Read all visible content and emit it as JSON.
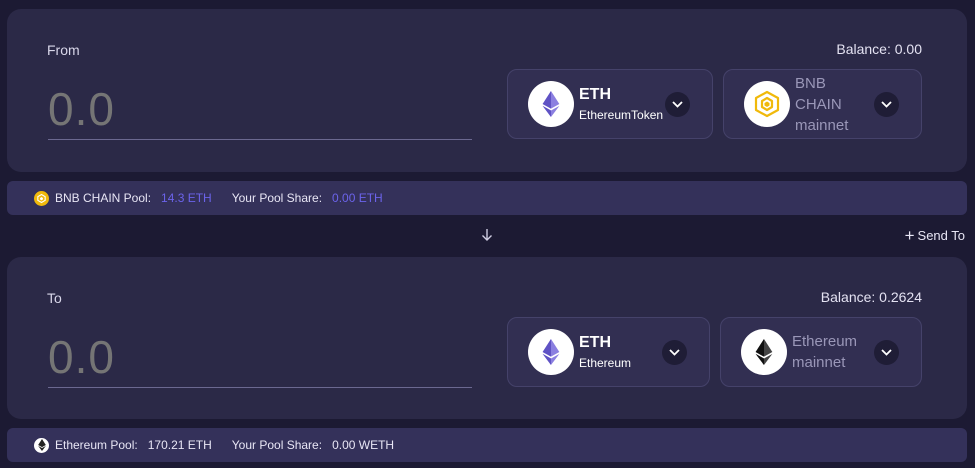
{
  "from": {
    "label": "From",
    "balance": "Balance: 0.00",
    "amount_placeholder": "0.0",
    "token": {
      "symbol": "ETH",
      "name": "EthereumToken",
      "icon": "ethereum-icon"
    },
    "network": {
      "name": "BNB CHAIN mainnet",
      "lines": [
        "BNB",
        "CHAIN",
        "mainnet"
      ],
      "icon": "bnb-chain-icon"
    },
    "pool": {
      "label": "BNB CHAIN Pool:",
      "value": "14.3 ETH",
      "share_label": "Your Pool Share:",
      "share_value": "0.00 ETH"
    }
  },
  "swap_arrow_icon": "arrow-down-icon",
  "send_to": {
    "icon": "plus-icon",
    "label": "Send To"
  },
  "to": {
    "label": "To",
    "balance": "Balance: 0.2624",
    "amount_placeholder": "0.0",
    "token": {
      "symbol": "ETH",
      "name": "Ethereum",
      "icon": "ethereum-icon"
    },
    "network": {
      "name": "Ethereum mainnet",
      "lines": [
        "Ethereum",
        "mainnet"
      ],
      "icon": "ethereum-icon"
    },
    "pool": {
      "label": "Ethereum Pool:",
      "value": "170.21 ETH",
      "share_label": "Your Pool Share:",
      "share_value": "0.00 WETH"
    }
  },
  "colors": {
    "background": "#1c1a33",
    "panel": "#2b2947",
    "accent": "#6b63ea",
    "bnb_yellow": "#f0b90b"
  }
}
